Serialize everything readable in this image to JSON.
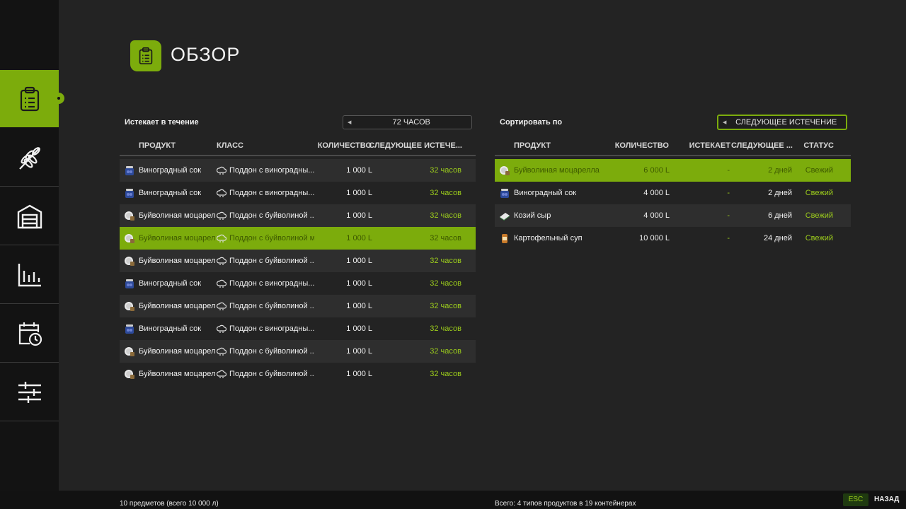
{
  "header": {
    "title": "ОБЗОР",
    "icon": "clipboard-icon"
  },
  "sidebar": {
    "items": [
      {
        "icon": "clipboard-icon",
        "active": true
      },
      {
        "icon": "wheat-icon",
        "active": false
      },
      {
        "icon": "warehouse-icon",
        "active": false
      },
      {
        "icon": "bar-chart-icon",
        "active": false
      },
      {
        "icon": "calendar-clock-icon",
        "active": false
      },
      {
        "icon": "sliders-icon",
        "active": false
      }
    ]
  },
  "left": {
    "filter_label": "Истекает в течение",
    "selector_value": "72 ЧАСОВ",
    "columns": [
      "ПРОДУКТ",
      "КЛАСС",
      "КОЛИЧЕСТВО",
      "СЛЕДУЮЩЕЕ ИСТЕЧЕ..."
    ],
    "rows": [
      {
        "product": "Виноградный сок",
        "icon": "grape-juice-icon",
        "class": "Поддон с виноградны...",
        "qty": "1 000 L",
        "next": "32 часов"
      },
      {
        "product": "Виноградный сок",
        "icon": "grape-juice-icon",
        "class": "Поддон с виноградны...",
        "qty": "1 000 L",
        "next": "32 часов"
      },
      {
        "product": "Буйволиная моцарел...",
        "icon": "mozzarella-icon",
        "class": "Поддон с буйволиной ...",
        "qty": "1 000 L",
        "next": "32 часов"
      },
      {
        "product": "Буйволиная моцарелла",
        "icon": "mozzarella-icon",
        "class": "Поддон с буйволиной мо",
        "qty": "1 000 L",
        "next": "32 часов",
        "selected": true
      },
      {
        "product": "Буйволиная моцарел...",
        "icon": "mozzarella-icon",
        "class": "Поддон с буйволиной ...",
        "qty": "1 000 L",
        "next": "32 часов"
      },
      {
        "product": "Виноградный сок",
        "icon": "grape-juice-icon",
        "class": "Поддон с виноградны...",
        "qty": "1 000 L",
        "next": "32 часов"
      },
      {
        "product": "Буйволиная моцарел...",
        "icon": "mozzarella-icon",
        "class": "Поддон с буйволиной ...",
        "qty": "1 000 L",
        "next": "32 часов"
      },
      {
        "product": "Виноградный сок",
        "icon": "grape-juice-icon",
        "class": "Поддон с виноградны...",
        "qty": "1 000 L",
        "next": "32 часов"
      },
      {
        "product": "Буйволиная моцарел...",
        "icon": "mozzarella-icon",
        "class": "Поддон с буйволиной ...",
        "qty": "1 000 L",
        "next": "32 часов"
      },
      {
        "product": "Буйволиная моцарел...",
        "icon": "mozzarella-icon",
        "class": "Поддон с буйволиной ...",
        "qty": "1 000 L",
        "next": "32 часов"
      }
    ],
    "footer": "10 предметов (всего 10 000 л)"
  },
  "right": {
    "filter_label": "Сортировать по",
    "selector_value": "СЛЕДУЮЩЕЕ ИСТЕЧЕНИЕ",
    "columns": [
      "ПРОДУКТ",
      "КОЛИЧЕСТВО",
      "ИСТЕКАЕТ",
      "СЛЕДУЮЩЕЕ ...",
      "СТАТУС"
    ],
    "rows": [
      {
        "product": "Буйволиная моцарелла",
        "icon": "mozzarella-icon",
        "qty": "6 000 L",
        "expires": "-",
        "next": "2 дней",
        "status": "Свежий",
        "selected": true
      },
      {
        "product": "Виноградный сок",
        "icon": "grape-juice-icon",
        "qty": "4 000 L",
        "expires": "-",
        "next": "2 дней",
        "status": "Свежий"
      },
      {
        "product": "Козий сыр",
        "icon": "goat-cheese-icon",
        "qty": "4 000 L",
        "expires": "-",
        "next": "6 дней",
        "status": "Свежий"
      },
      {
        "product": "Картофельный суп",
        "icon": "potato-soup-icon",
        "qty": "10 000 L",
        "expires": "-",
        "next": "24 дней",
        "status": "Свежий"
      }
    ],
    "footer": "Всего: 4 типов продуктов в 19 контейнерах"
  },
  "footer": {
    "esc_key": "ESC",
    "back_label": "НАЗАД"
  },
  "colors": {
    "accent": "#7cac0c",
    "accent_text": "#9ccc1c",
    "background": "#232323",
    "sidebar": "#131313"
  }
}
